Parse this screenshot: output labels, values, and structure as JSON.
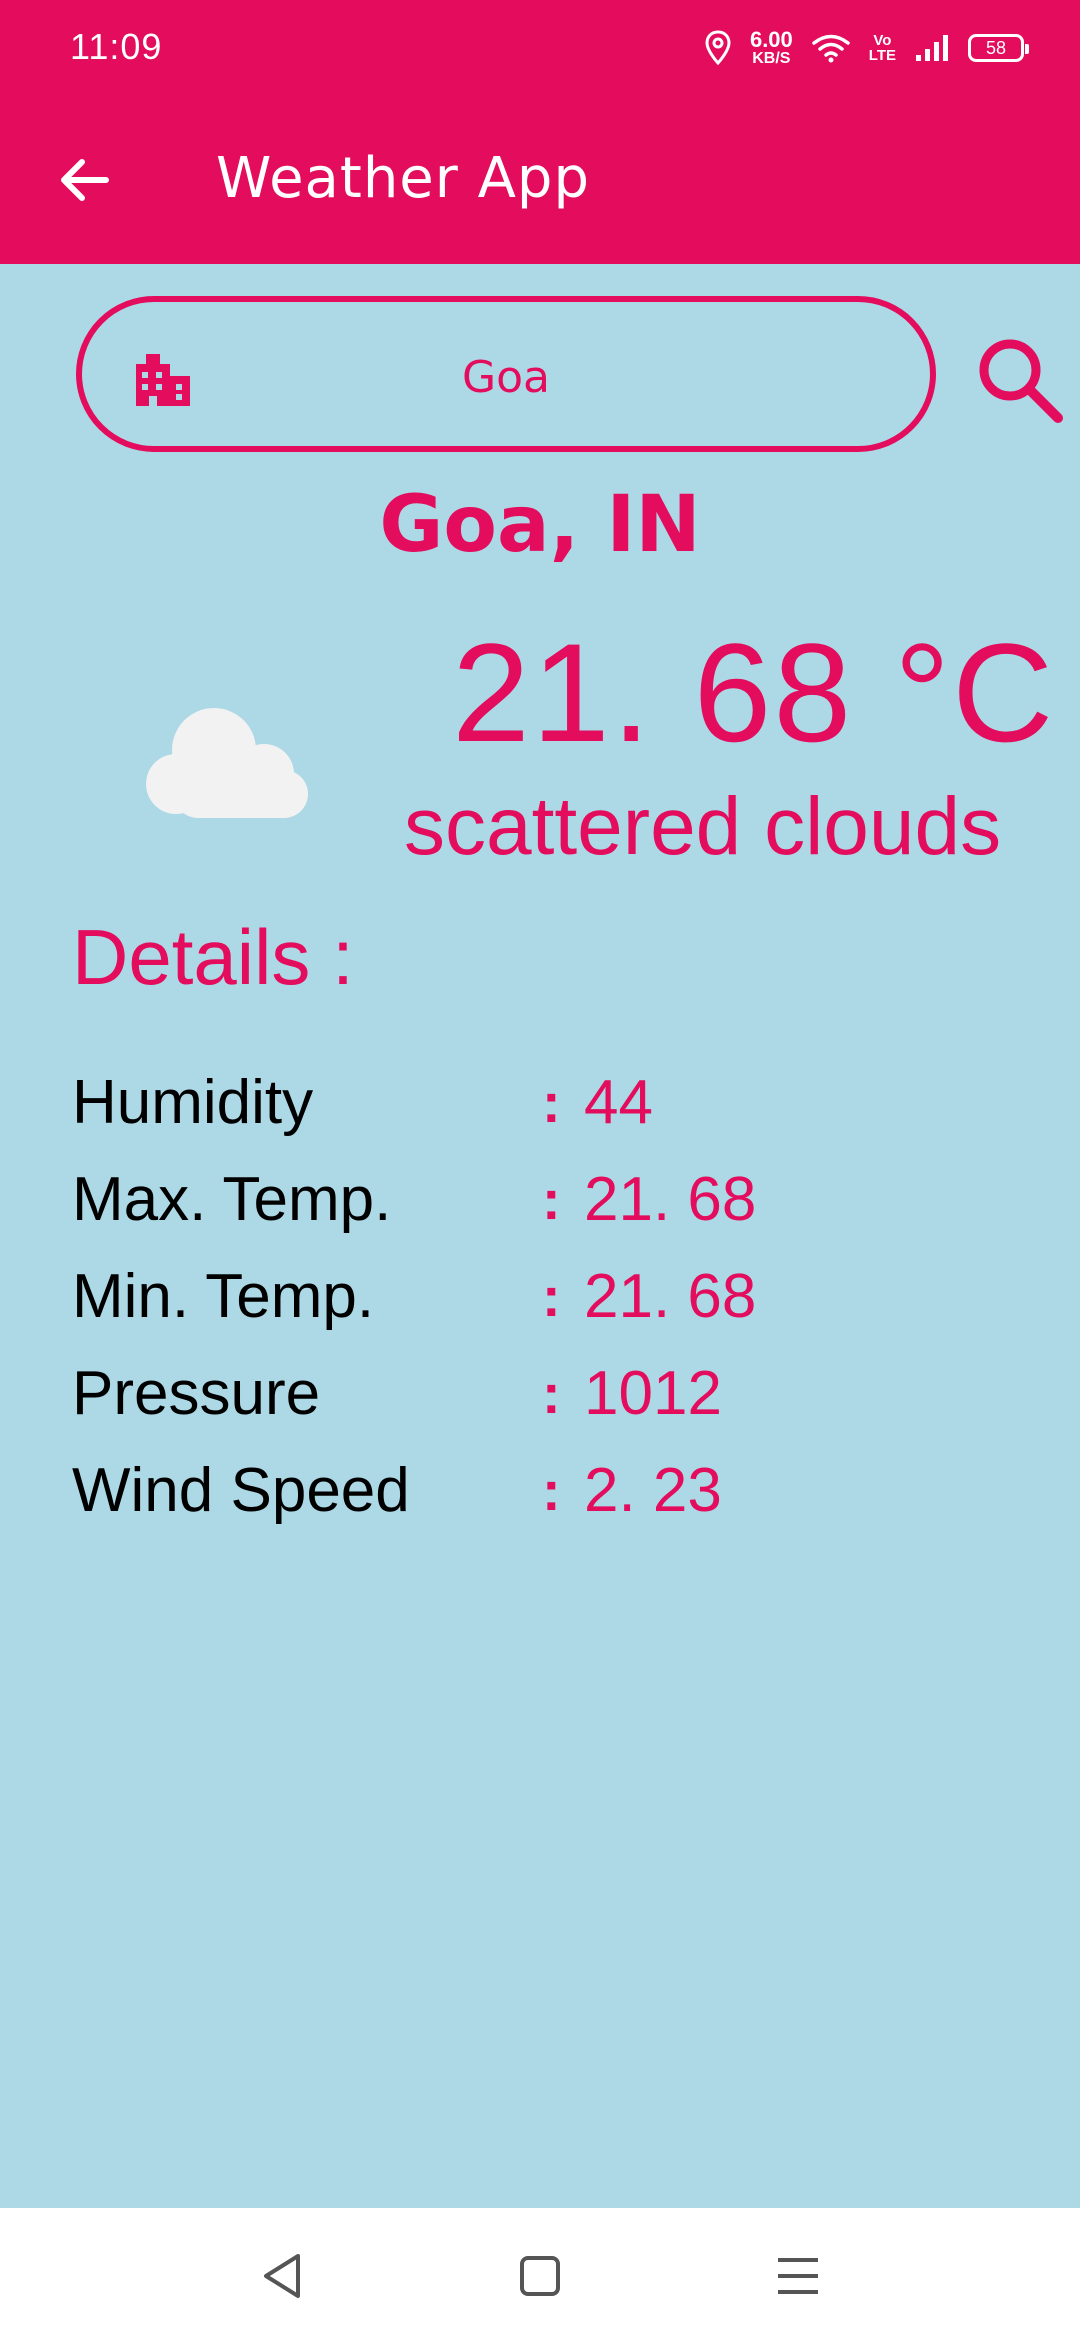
{
  "status_bar": {
    "time": "11:09",
    "net_speed_value": "6.00",
    "net_speed_unit": "KB/S",
    "volte_top": "Vo",
    "volte_bottom": "LTE",
    "battery": "58"
  },
  "app_bar": {
    "title": "Weather App"
  },
  "search": {
    "value": "Goa"
  },
  "weather": {
    "location": "Goa,  IN",
    "temperature": "21. 68 °C",
    "description": "scattered clouds",
    "icon": "cloud-icon"
  },
  "details": {
    "title": "Details  :",
    "rows": [
      {
        "label": "Humidity",
        "colon": ":",
        "value": "44"
      },
      {
        "label": "Max.  Temp.",
        "colon": ":",
        "value": "21. 68"
      },
      {
        "label": "Min.  Temp.",
        "colon": ":",
        "value": "21. 68"
      },
      {
        "label": "Pressure",
        "colon": ":",
        "value": "1012"
      },
      {
        "label": "Wind Speed",
        "colon": ":",
        "value": "2. 23"
      }
    ]
  },
  "colors": {
    "accent": "#E30C5D",
    "background": "#ADD8E6",
    "nav_bar": "#FFFFFF"
  }
}
